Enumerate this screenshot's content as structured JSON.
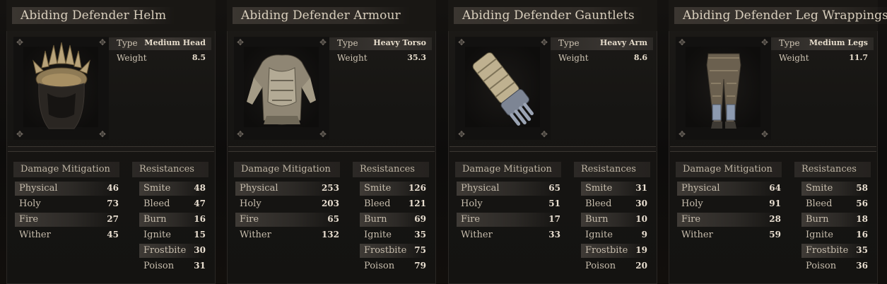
{
  "cards": [
    {
      "title": "Abiding Defender Helm",
      "type_label": "Type",
      "type_value": "Medium Head",
      "weight_label": "Weight",
      "weight_value": "8.5",
      "icon": "helm-icon",
      "dm_header": "Damage Mitigation",
      "res_header": "Resistances",
      "mitigation": [
        {
          "label": "Physical",
          "value": "46"
        },
        {
          "label": "Holy",
          "value": "73"
        },
        {
          "label": "Fire",
          "value": "27"
        },
        {
          "label": "Wither",
          "value": "45"
        }
      ],
      "resistances": [
        {
          "label": "Smite",
          "value": "48"
        },
        {
          "label": "Bleed",
          "value": "47"
        },
        {
          "label": "Burn",
          "value": "16"
        },
        {
          "label": "Ignite",
          "value": "15"
        },
        {
          "label": "Frostbite",
          "value": "30"
        },
        {
          "label": "Poison",
          "value": "31"
        }
      ]
    },
    {
      "title": "Abiding Defender Armour",
      "type_label": "Type",
      "type_value": "Heavy Torso",
      "weight_label": "Weight",
      "weight_value": "35.3",
      "icon": "armour-icon",
      "dm_header": "Damage Mitigation",
      "res_header": "Resistances",
      "mitigation": [
        {
          "label": "Physical",
          "value": "253"
        },
        {
          "label": "Holy",
          "value": "203"
        },
        {
          "label": "Fire",
          "value": "65"
        },
        {
          "label": "Wither",
          "value": "132"
        }
      ],
      "resistances": [
        {
          "label": "Smite",
          "value": "126"
        },
        {
          "label": "Bleed",
          "value": "121"
        },
        {
          "label": "Burn",
          "value": "69"
        },
        {
          "label": "Ignite",
          "value": "35"
        },
        {
          "label": "Frostbite",
          "value": "75"
        },
        {
          "label": "Poison",
          "value": "79"
        }
      ]
    },
    {
      "title": "Abiding Defender Gauntlets",
      "type_label": "Type",
      "type_value": "Heavy Arm",
      "weight_label": "Weight",
      "weight_value": "8.6",
      "icon": "gauntlet-icon",
      "dm_header": "Damage Mitigation",
      "res_header": "Resistances",
      "mitigation": [
        {
          "label": "Physical",
          "value": "65"
        },
        {
          "label": "Holy",
          "value": "51"
        },
        {
          "label": "Fire",
          "value": "17"
        },
        {
          "label": "Wither",
          "value": "33"
        }
      ],
      "resistances": [
        {
          "label": "Smite",
          "value": "31"
        },
        {
          "label": "Bleed",
          "value": "30"
        },
        {
          "label": "Burn",
          "value": "10"
        },
        {
          "label": "Ignite",
          "value": "9"
        },
        {
          "label": "Frostbite",
          "value": "19"
        },
        {
          "label": "Poison",
          "value": "20"
        }
      ]
    },
    {
      "title": "Abiding Defender Leg Wrappings",
      "type_label": "Type",
      "type_value": "Medium Legs",
      "weight_label": "Weight",
      "weight_value": "11.7",
      "icon": "leg-wrappings-icon",
      "dm_header": "Damage Mitigation",
      "res_header": "Resistances",
      "mitigation": [
        {
          "label": "Physical",
          "value": "64"
        },
        {
          "label": "Holy",
          "value": "91"
        },
        {
          "label": "Fire",
          "value": "28"
        },
        {
          "label": "Wither",
          "value": "59"
        }
      ],
      "resistances": [
        {
          "label": "Smite",
          "value": "58"
        },
        {
          "label": "Bleed",
          "value": "56"
        },
        {
          "label": "Burn",
          "value": "18"
        },
        {
          "label": "Ignite",
          "value": "16"
        },
        {
          "label": "Frostbite",
          "value": "35"
        },
        {
          "label": "Poison",
          "value": "36"
        }
      ]
    }
  ]
}
